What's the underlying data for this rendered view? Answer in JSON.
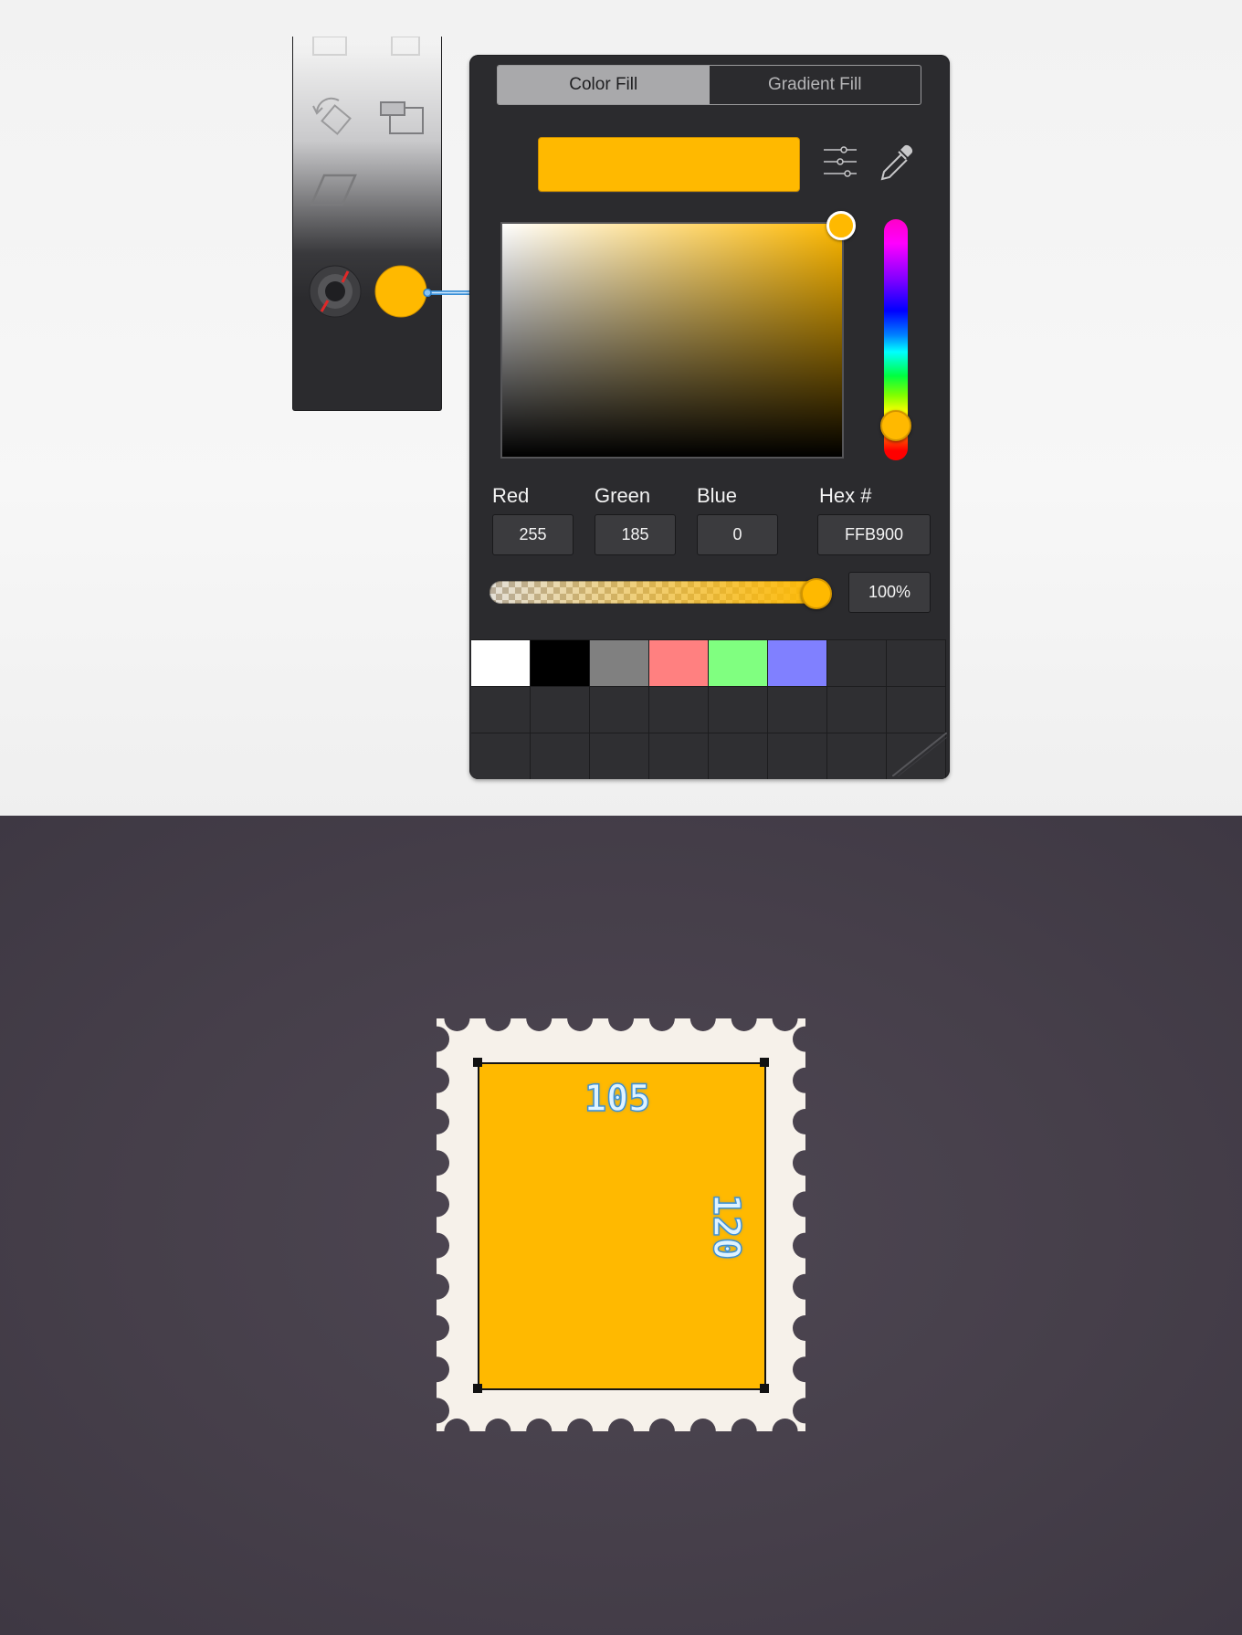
{
  "fill_panel": {
    "tabs": [
      {
        "label": "Color Fill",
        "active": true
      },
      {
        "label": "Gradient Fill",
        "active": false
      }
    ],
    "current_color": "#FFB900",
    "rgb": {
      "red_label": "Red",
      "red": "255",
      "green_label": "Green",
      "green": "185",
      "blue_label": "Blue",
      "blue": "0"
    },
    "hex_label": "Hex #",
    "hex_value": "FFB900",
    "opacity": "100%",
    "opacity_fraction": 1.0,
    "palette": [
      "#FFFFFF",
      "#000000",
      "#808080",
      "#FF8080",
      "#80FF80",
      "#8080FF",
      "",
      "",
      "",
      "",
      "",
      "",
      "",
      "",
      "",
      "",
      "",
      "",
      "",
      "",
      "",
      "",
      "",
      ""
    ],
    "icons": [
      "color-sliders-icon",
      "eyedropper-icon",
      "resize-grip-icon"
    ]
  },
  "toolbar": {
    "icons": [
      "rotate-icon",
      "arrange-icon",
      "skew-icon",
      "stroke-ring-icon",
      "fill-swatch-icon"
    ],
    "fill_color": "#FFB900"
  },
  "canvas": {
    "stamp_color": "#FFB900",
    "stamp_border_color": "#F6F1EA",
    "background_color": "#48414D",
    "width_label": "105",
    "height_label": "120"
  }
}
